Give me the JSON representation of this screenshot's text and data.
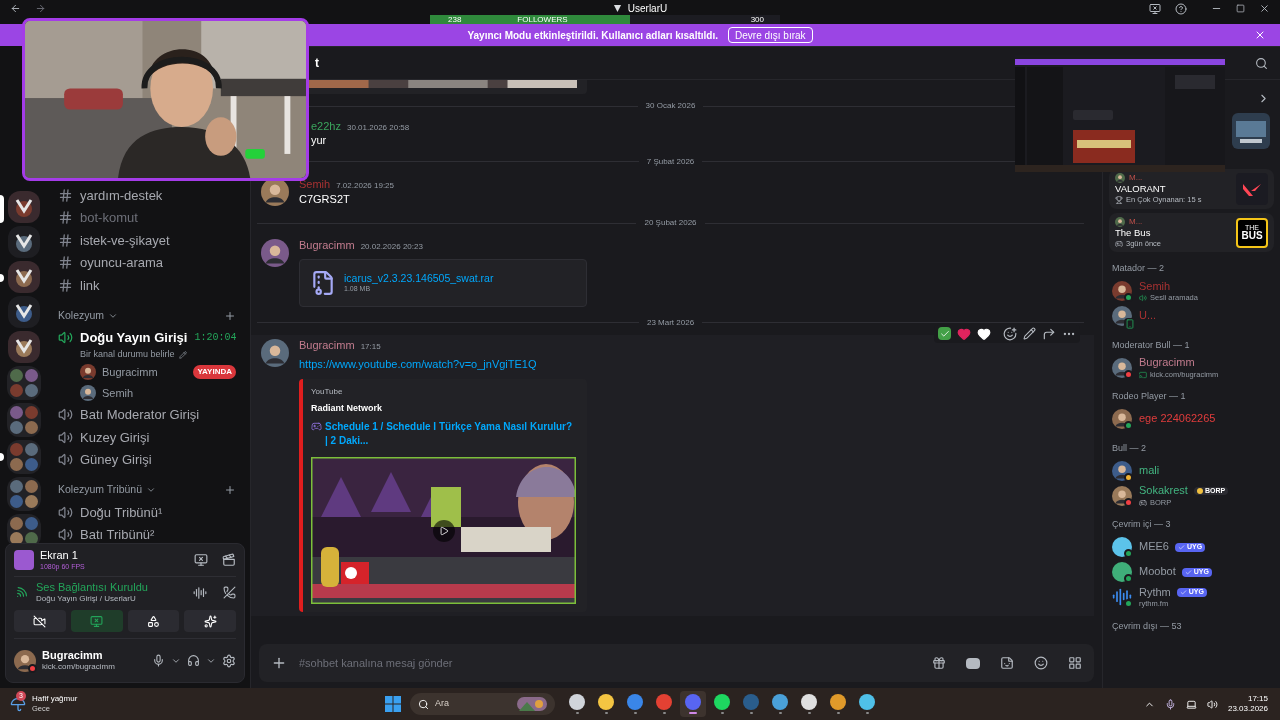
{
  "title_bar": {
    "title": "UserlarU"
  },
  "follower_goal": {
    "current": "238",
    "label": "FOLLOWERS",
    "goal": "300",
    "level": 0.57
  },
  "banner": {
    "text": "Yayıncı Modu etkinleştirildi. Kullanıcı adları kısaltıldı.",
    "button": "Devre dışı bırak"
  },
  "servers": [
    {
      "kind": "single",
      "selected": true,
      "unread": false
    },
    {
      "kind": "single",
      "selected": false,
      "unread": false
    },
    {
      "kind": "single",
      "selected": false,
      "unread": true
    },
    {
      "kind": "single",
      "selected": false,
      "unread": false
    },
    {
      "kind": "single",
      "selected": false,
      "unread": false
    },
    {
      "kind": "folder",
      "selected": false,
      "unread": false
    },
    {
      "kind": "folder",
      "selected": false,
      "unread": false
    },
    {
      "kind": "folder",
      "selected": false,
      "unread": true
    },
    {
      "kind": "folder",
      "selected": false,
      "unread": false
    },
    {
      "kind": "folder",
      "selected": false,
      "unread": false
    }
  ],
  "channel_header": {
    "fragment": "t"
  },
  "text_channels": [
    {
      "name": "yardım-destek",
      "muted": false
    },
    {
      "name": "bot-komut",
      "muted": true
    },
    {
      "name": "istek-ve-şikayet",
      "muted": false
    },
    {
      "name": "oyuncu-arama",
      "muted": false
    },
    {
      "name": "link",
      "muted": false
    }
  ],
  "categories": [
    {
      "name": "Kolezyum",
      "channels": [
        {
          "name": "Doğu Yayın Girişi",
          "kind": "active",
          "timer": "1:20:04",
          "status": "Bir kanal durumu belirle",
          "users": [
            {
              "name": "Bugracimm",
              "badge": "YAYINDA"
            },
            {
              "name": "Semih"
            }
          ]
        },
        {
          "name": "Batı Moderator Girişi",
          "kind": "locked"
        },
        {
          "name": "Kuzey Girişi",
          "kind": "locked"
        },
        {
          "name": "Güney Girişi",
          "kind": "locked"
        }
      ]
    },
    {
      "name": "Kolezyum Tribünü",
      "channels": [
        {
          "name": "Doğu Tribünü¹",
          "kind": "voice"
        },
        {
          "name": "Batı Tribünü²",
          "kind": "voice"
        }
      ]
    }
  ],
  "messages": [
    {
      "kind": "image_tail"
    },
    {
      "kind": "divider",
      "label": "30 Ocak 2026"
    },
    {
      "kind": "partial",
      "author": "e22hz",
      "color": "#3ba55d",
      "time": "30.01.2026 20:58",
      "text": "yur"
    },
    {
      "kind": "divider",
      "label": "7 Şubat 2026"
    },
    {
      "kind": "message",
      "author": "Semih",
      "color": "#a83232",
      "time": "7.02.2026 19:25",
      "text": "C7GRS2T",
      "hovered": false
    },
    {
      "kind": "divider",
      "label": "20 Şubat 2026"
    },
    {
      "kind": "message",
      "author": "Bugracimm",
      "color": "#c27c8e",
      "time": "20.02.2026 20:23",
      "hovered": false,
      "attachment": {
        "name": "icarus_v2.3.23.146505_swat.rar",
        "size": "1.08 MB"
      }
    },
    {
      "kind": "divider",
      "label": "23 Mart 2026"
    },
    {
      "kind": "message",
      "author": "Bugracimm",
      "color": "#c27c8e",
      "time": "17:15",
      "hovered": true,
      "link": "https://www.youtube.com/watch?v=o_jnVgiTE1Q",
      "embed": {
        "provider": "YouTube",
        "author": "Radiant Network",
        "title": "Schedule 1 / Schedule I Türkçe Yama Nasıl Kurulur? | 2 Daki..."
      }
    }
  ],
  "composer": {
    "placeholder": "#sohbet kanalına mesaj gönder"
  },
  "activities": [
    {
      "user": "M...",
      "title": "VALORANT",
      "detail": "En Çok Oynanan: 15 s",
      "kind": "valorant"
    },
    {
      "user": "M...",
      "title": "The Bus",
      "detail": "3gün önce",
      "kind": "bus",
      "logo_lines": [
        "THE",
        "BUS"
      ]
    }
  ],
  "member_groups": [
    {
      "title": "Matador — 2",
      "members": [
        {
          "name": "Semih",
          "color": "#a83232",
          "status": {
            "kind": "online"
          },
          "sub": {
            "text": "Sesli aramada",
            "kind": "voice"
          }
        },
        {
          "name": "U...",
          "color": "#a83232",
          "status": {
            "kind": "mobile"
          }
        }
      ]
    },
    {
      "title": "Moderator Bull — 1",
      "members": [
        {
          "name": "Bugracimm",
          "color": "#c27c8e",
          "status": {
            "kind": "dnd"
          },
          "sub": {
            "text": "kick.com/bugracimm",
            "kind": "stream"
          }
        }
      ]
    },
    {
      "title": "Rodeo Player — 1",
      "members": [
        {
          "name": "ege 224062265",
          "color": "#e03c3c",
          "status": {
            "kind": "online"
          }
        }
      ]
    },
    {
      "title": "Bull — 2",
      "members": [
        {
          "name": "mali",
          "color": "#43b581",
          "status": {
            "kind": "idle"
          }
        },
        {
          "name": "Sokakrest",
          "color": "#43b581",
          "status": {
            "kind": "dnd"
          },
          "tag": {
            "text": "BORP",
            "kind": "guild"
          },
          "sub": {
            "text": "BORP",
            "kind": "game"
          }
        }
      ]
    },
    {
      "title": "Çevrim içi — 3",
      "members": [
        {
          "name": "MEE6",
          "color": "#949ba4",
          "kind": "mee6",
          "status": {
            "kind": "online"
          },
          "tag": {
            "text": "UYG",
            "kind": "app"
          }
        },
        {
          "name": "Moobot",
          "color": "#949ba4",
          "kind": "moobot",
          "status": {
            "kind": "online"
          },
          "tag": {
            "text": "UYG",
            "kind": "app"
          }
        },
        {
          "name": "Rythm",
          "color": "#949ba4",
          "kind": "rythm",
          "status": {
            "kind": "online"
          },
          "tag": {
            "text": "UYG",
            "kind": "app"
          },
          "sub": {
            "text": "rythm.fm",
            "kind": "plain"
          }
        }
      ]
    },
    {
      "title": "Çevrim dışı — 53"
    }
  ],
  "stream": {
    "title": "Ekran 1",
    "quality": "1080p 60 FPS"
  },
  "voice": {
    "status": "Ses Bağlantısı Kuruldu",
    "channel": "Doğu Yayın Girişi / UserlarU"
  },
  "voice_buttons": [
    {
      "kind": "camera",
      "selected": false
    },
    {
      "kind": "screen",
      "selected": true
    },
    {
      "kind": "activity",
      "selected": false
    },
    {
      "kind": "soundboard",
      "selected": false
    }
  ],
  "user": {
    "name": "Bugracimm",
    "status_text": "kick.com/bugracimm"
  },
  "taskbar": {
    "weather": {
      "title": "Hafif yağmur",
      "subtitle": "Gece",
      "badge": "3"
    },
    "search_placeholder": "Ara",
    "apps": [
      {
        "kind": "taskview",
        "active": false
      },
      {
        "kind": "explorer",
        "active": false
      },
      {
        "kind": "store",
        "active": false
      },
      {
        "kind": "chrome",
        "active": false
      },
      {
        "kind": "discord",
        "active": true
      },
      {
        "kind": "spotify",
        "active": false
      },
      {
        "kind": "steam",
        "active": false
      },
      {
        "kind": "tool",
        "active": false
      },
      {
        "kind": "obs",
        "active": false
      },
      {
        "kind": "audio",
        "active": false
      },
      {
        "kind": "notepad",
        "active": false
      }
    ],
    "time": "17:15",
    "date": "23.03.2026"
  }
}
